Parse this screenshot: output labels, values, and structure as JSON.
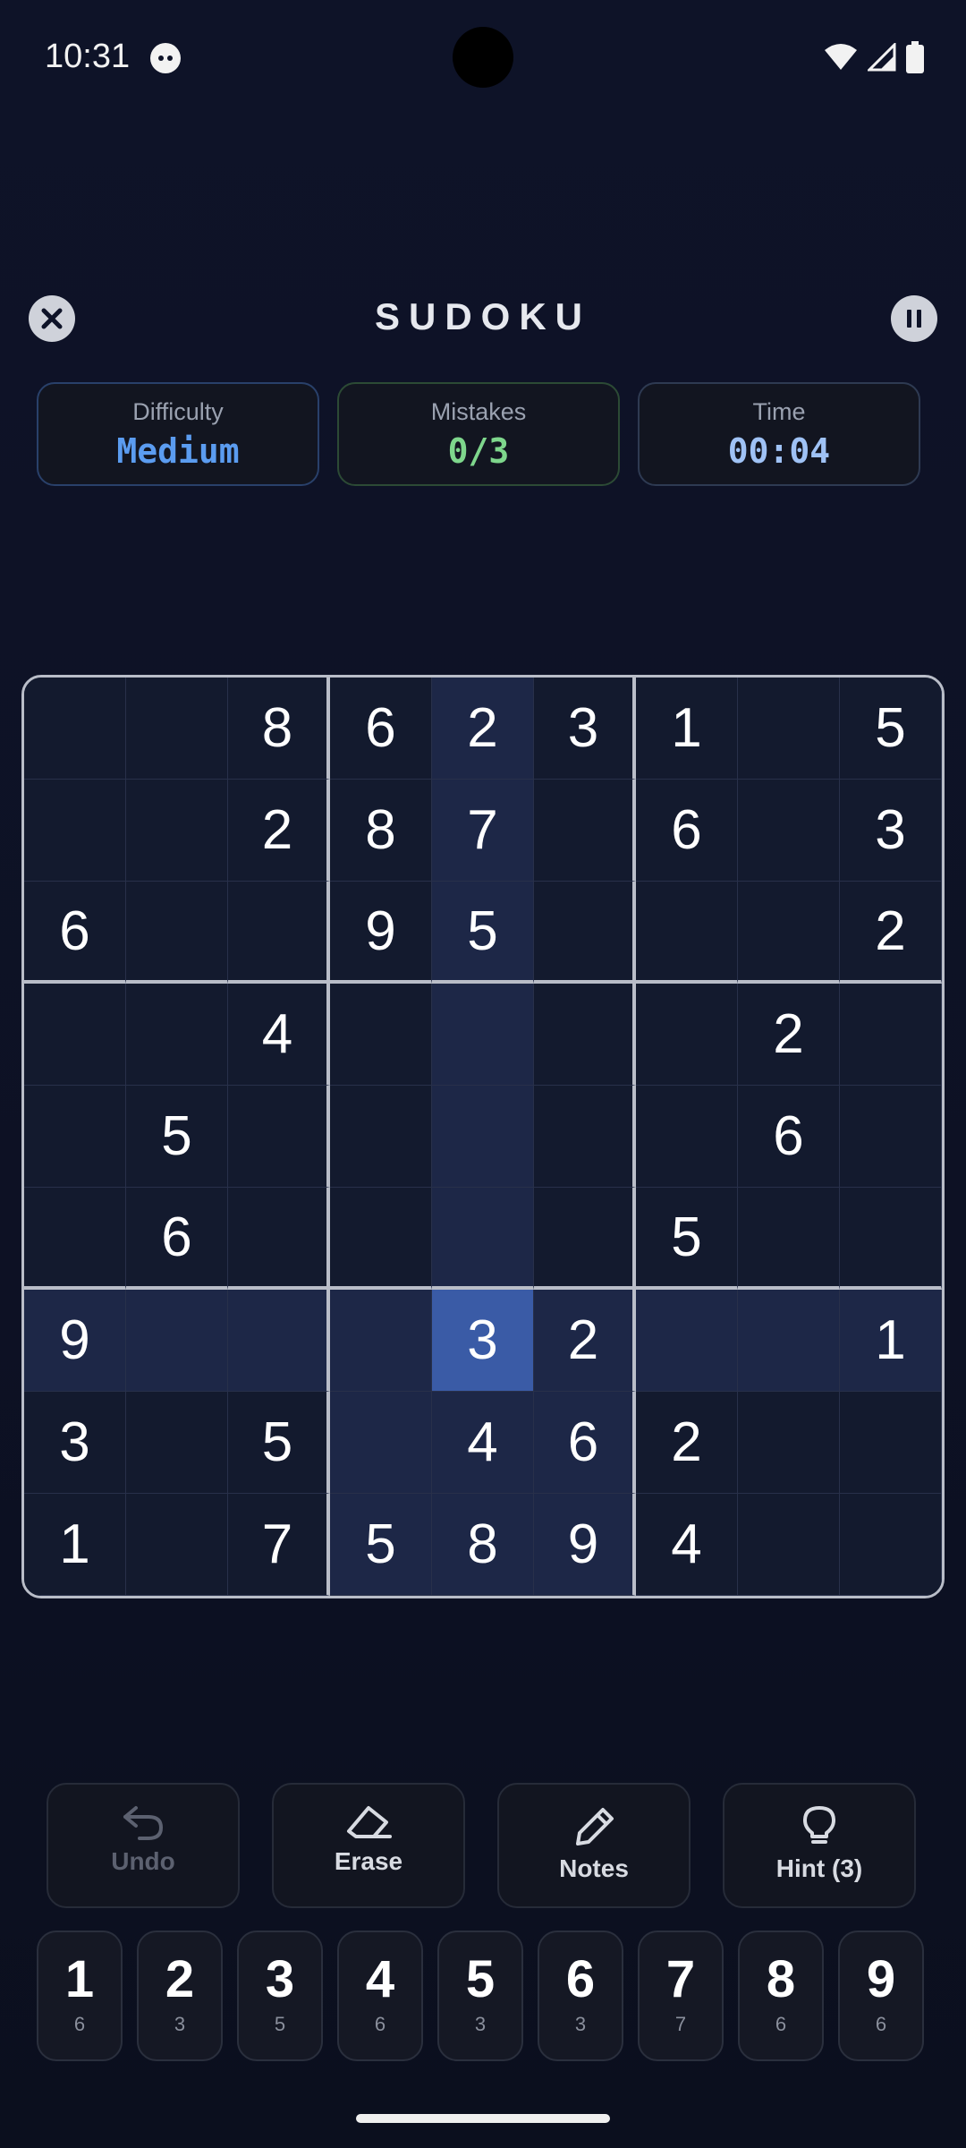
{
  "status_bar": {
    "time": "10:31",
    "icons": [
      "cat-notification-icon",
      "wifi-icon",
      "signal-icon",
      "battery-icon"
    ]
  },
  "header": {
    "title": "SUDOKU",
    "close_icon": "close-icon",
    "pause_icon": "pause-icon"
  },
  "stats": {
    "difficulty": {
      "label": "Difficulty",
      "value": "Medium",
      "color": "#5b9cf0"
    },
    "mistakes": {
      "label": "Mistakes",
      "value": "0/3",
      "color": "#7ed68c"
    },
    "time": {
      "label": "Time",
      "value": "00:04",
      "color": "#9fc2f5"
    }
  },
  "board": {
    "cells": [
      [
        "",
        "",
        "8",
        "6",
        "2",
        "3",
        "1",
        "",
        "5"
      ],
      [
        "",
        "",
        "2",
        "8",
        "7",
        "",
        "6",
        "",
        "3"
      ],
      [
        "6",
        "",
        "",
        "9",
        "5",
        "",
        "",
        "",
        "2"
      ],
      [
        "",
        "",
        "4",
        "",
        "",
        "",
        "",
        "2",
        ""
      ],
      [
        "",
        "5",
        "",
        "",
        "",
        "",
        "",
        "6",
        ""
      ],
      [
        "",
        "6",
        "",
        "",
        "",
        "",
        "5",
        "",
        ""
      ],
      [
        "9",
        "",
        "",
        "",
        "3",
        "2",
        "",
        "",
        "1"
      ],
      [
        "3",
        "",
        "5",
        "",
        "4",
        "6",
        "2",
        "",
        ""
      ],
      [
        "1",
        "",
        "7",
        "5",
        "8",
        "9",
        "4",
        "",
        ""
      ]
    ],
    "selected": {
      "row": 6,
      "col": 4
    },
    "colors": {
      "selected": "#3a5ba6",
      "highlight": "#1d2747",
      "cell": "#131a2e"
    }
  },
  "tools": [
    {
      "label": "Undo",
      "icon": "undo-icon",
      "enabled": false
    },
    {
      "label": "Erase",
      "icon": "eraser-icon",
      "enabled": true
    },
    {
      "label": "Notes",
      "icon": "pencil-icon",
      "enabled": true
    },
    {
      "label": "Hint (3)",
      "icon": "lightbulb-icon",
      "enabled": true
    }
  ],
  "numpad": [
    {
      "digit": "1",
      "remaining": "6"
    },
    {
      "digit": "2",
      "remaining": "3"
    },
    {
      "digit": "3",
      "remaining": "5"
    },
    {
      "digit": "4",
      "remaining": "6"
    },
    {
      "digit": "5",
      "remaining": "3"
    },
    {
      "digit": "6",
      "remaining": "3"
    },
    {
      "digit": "7",
      "remaining": "7"
    },
    {
      "digit": "8",
      "remaining": "6"
    },
    {
      "digit": "9",
      "remaining": "6"
    }
  ]
}
